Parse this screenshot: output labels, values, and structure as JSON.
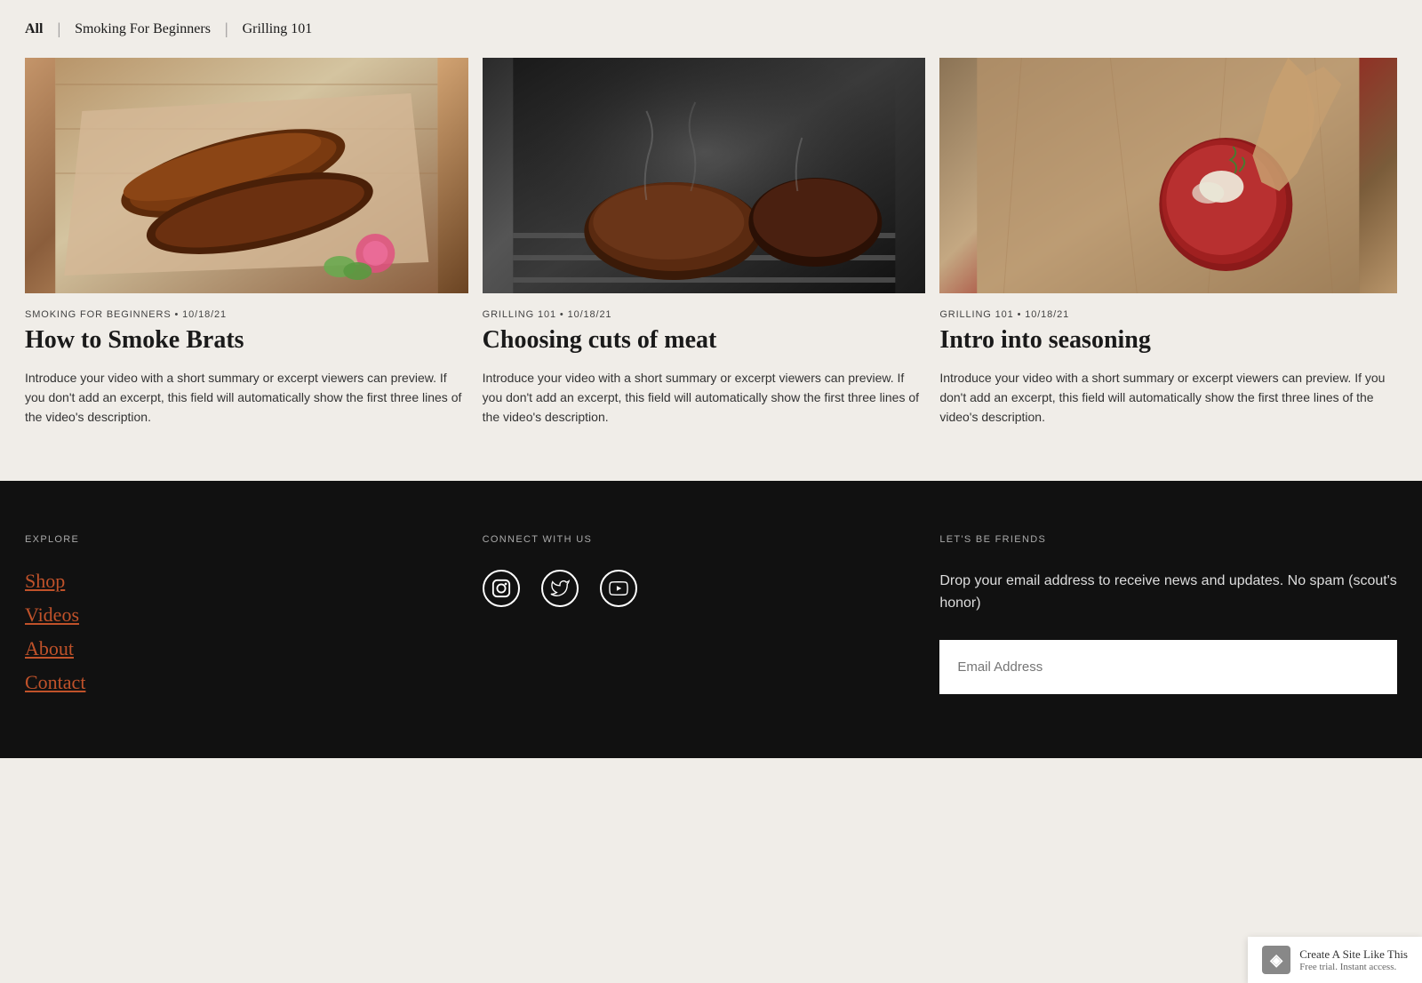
{
  "filter": {
    "all_label": "All",
    "sep1": "|",
    "smoking_label": "Smoking For Beginners",
    "sep2": "|",
    "grilling_label": "Grilling 101"
  },
  "cards": [
    {
      "meta": "SMOKING FOR BEGINNERS • 10/18/21",
      "title": "How to Smoke Brats",
      "excerpt": "Introduce your video with a short summary or excerpt viewers can preview. If you don't add an excerpt, this field will automatically show the first three lines of the video's description.",
      "image_alt": "Smoked brats on paper with vegetables"
    },
    {
      "meta": "GRILLING 101 • 10/18/21",
      "title": "Choosing cuts of meat",
      "excerpt": "Introduce your video with a short summary or excerpt viewers can preview. If you don't add an excerpt, this field will automatically show the first three lines of the video's description.",
      "image_alt": "Grilling cuts of meat with smoke"
    },
    {
      "meta": "GRILLING 101 • 10/18/21",
      "title": "Intro into seasoning",
      "excerpt": "Introduce your video with a short summary or excerpt viewers can preview. If you don't add an excerpt, this field will automatically show the first three lines of the video's description.",
      "image_alt": "Hand seasoning a cut of meat on paper"
    }
  ],
  "footer": {
    "explore_title": "EXPLORE",
    "nav_links": [
      "Shop",
      "Videos",
      "About",
      "Contact"
    ],
    "connect_title": "CONNECT WITH US",
    "friends_title": "LET'S BE FRIENDS",
    "friends_desc": "Drop your email address to receive news and updates. No spam (scout's honor)",
    "email_placeholder": "Email Address"
  },
  "badge": {
    "main": "Create A Site Like This",
    "sub": "Free trial. Instant access."
  }
}
